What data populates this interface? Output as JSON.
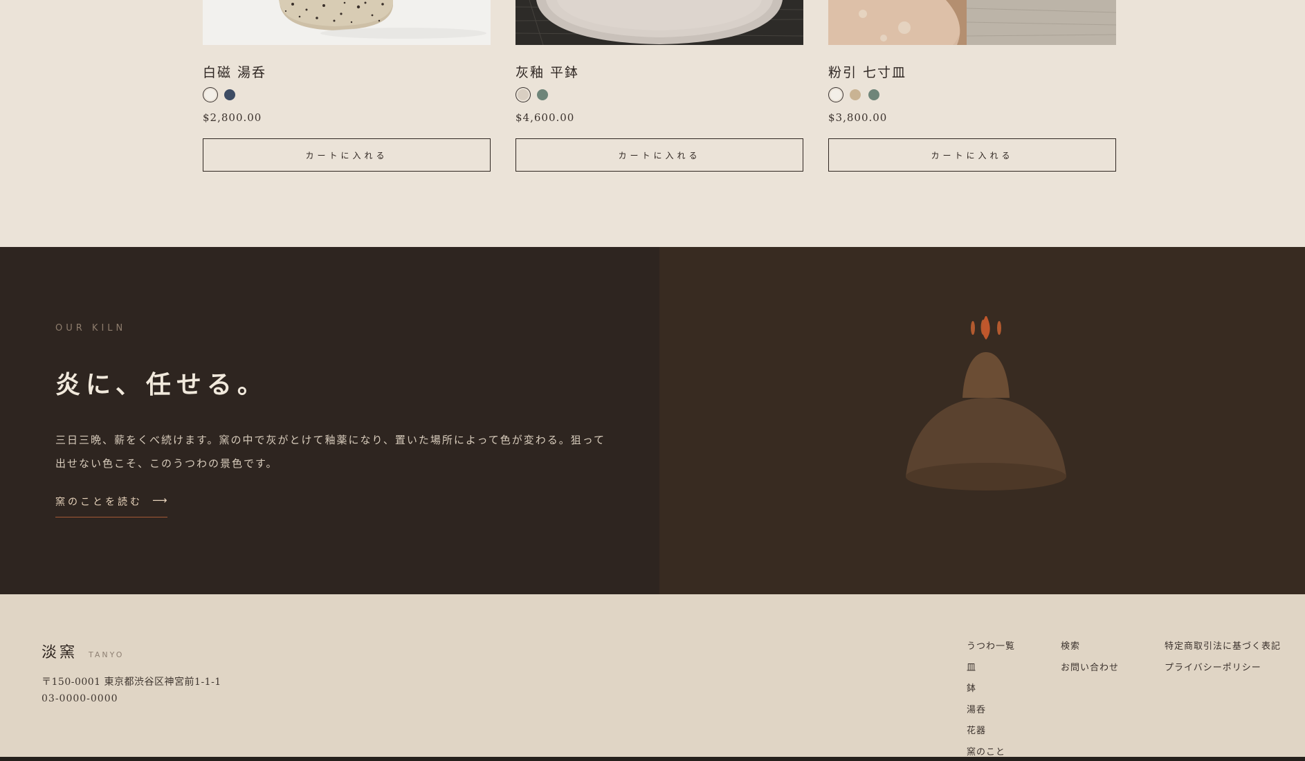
{
  "products": [
    {
      "name": "白磁 湯呑",
      "price": "$2,800.00",
      "cart_label": "カートに入れる",
      "image_alt": "speckled stoneware cup",
      "swatches": [
        {
          "color": "#f3efe8",
          "selected": true
        },
        {
          "color": "#3d4c64",
          "selected": false
        }
      ]
    },
    {
      "name": "灰釉 平鉢",
      "price": "$4,600.00",
      "cart_label": "カートに入れる",
      "image_alt": "ash glazed plate",
      "swatches": [
        {
          "color": "#d9cfc2",
          "selected": true
        },
        {
          "color": "#6e8579",
          "selected": false
        }
      ]
    },
    {
      "name": "粉引 七寸皿",
      "price": "$3,800.00",
      "cart_label": "カートに入れる",
      "image_alt": "kohiki plate on linen",
      "swatches": [
        {
          "color": "#f3efe8",
          "selected": true
        },
        {
          "color": "#c9b393",
          "selected": false
        },
        {
          "color": "#6e8579",
          "selected": false
        }
      ]
    }
  ],
  "kiln": {
    "eyebrow": "OUR KILN",
    "heading": "炎に、任せる。",
    "body": "三日三晩、薪をくべ続けます。窯の中で灰がとけて釉薬になり、置いた場所によって色が変わる。狙って出せない色こそ、このうつわの景色です。",
    "link_label": "窯のことを読む",
    "link_arrow": "⟶"
  },
  "footer": {
    "brand_name": "淡窯",
    "brand_sub": "TANYO",
    "address": "〒150-0001 東京都渋谷区神宮前1-1-1",
    "phone": "03-0000-0000",
    "col1": [
      "うつわ一覧",
      "皿",
      "鉢",
      "湯呑",
      "花器",
      "窯のこと"
    ],
    "col2": [
      "検索",
      "お問い合わせ"
    ],
    "col3": [
      "特定商取引法に基づく表記",
      "プライバシーポリシー"
    ]
  },
  "colors": {
    "page_bg": "#ebe3d8",
    "kiln_left_bg": "#2e2520",
    "kiln_right_bg": "#382b21",
    "accent_rust": "#a45a36",
    "footer_bg": "#e0d5c5"
  }
}
